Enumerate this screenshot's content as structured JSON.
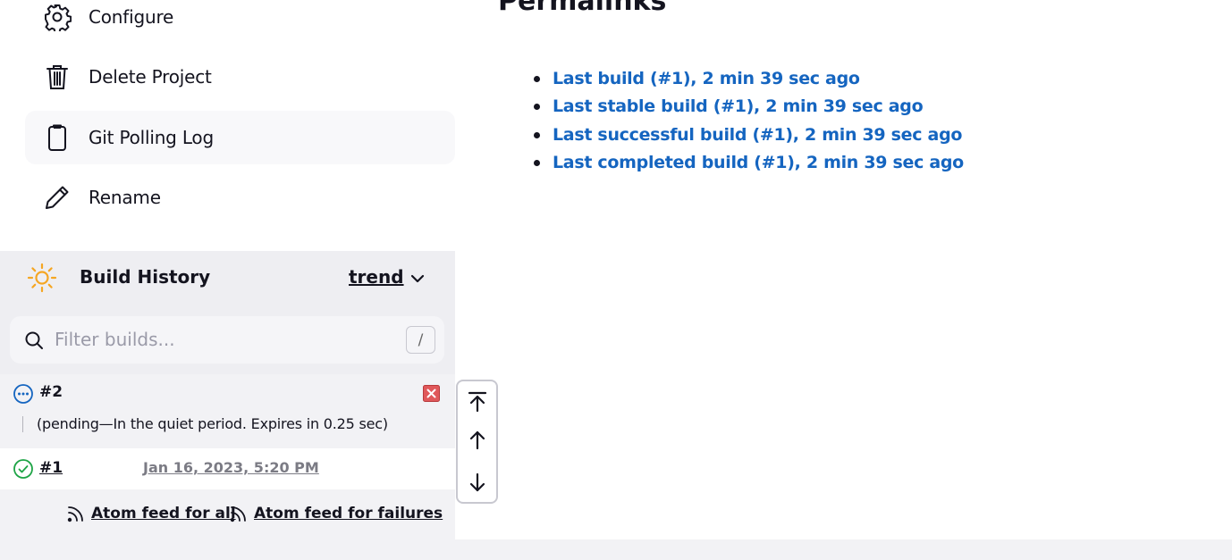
{
  "sidebar": {
    "tasks": [
      {
        "label": "Configure",
        "icon": "gear-icon"
      },
      {
        "label": "Delete Project",
        "icon": "trash-icon"
      },
      {
        "label": "Git Polling Log",
        "icon": "clipboard-icon"
      },
      {
        "label": "Rename",
        "icon": "pencil-icon"
      }
    ]
  },
  "build_history": {
    "title": "Build History",
    "trend_label": "trend",
    "filter": {
      "placeholder": "Filter builds...",
      "shortcut": "/"
    },
    "builds": [
      {
        "number": "#2",
        "status": "pending",
        "description": "(pending—In the quiet period. Expires in 0.25 sec)"
      },
      {
        "number": "#1",
        "status": "success",
        "date": "Jan 16, 2023, 5:20 PM"
      }
    ],
    "feeds": {
      "all": "Atom feed for all",
      "failures": "Atom feed for failures"
    }
  },
  "permalinks": {
    "title": "Permalinks",
    "items": [
      "Last build (#1), 2 min 39 sec ago",
      "Last stable build (#1), 2 min 39 sec ago",
      "Last successful build (#1), 2 min 39 sec ago",
      "Last completed build (#1), 2 min 39 sec ago"
    ]
  },
  "colors": {
    "link": "#1565c0",
    "pending": "#1565c0",
    "success": "#1ea446",
    "sun": "#f5a623",
    "cancel": "#d9393b"
  }
}
